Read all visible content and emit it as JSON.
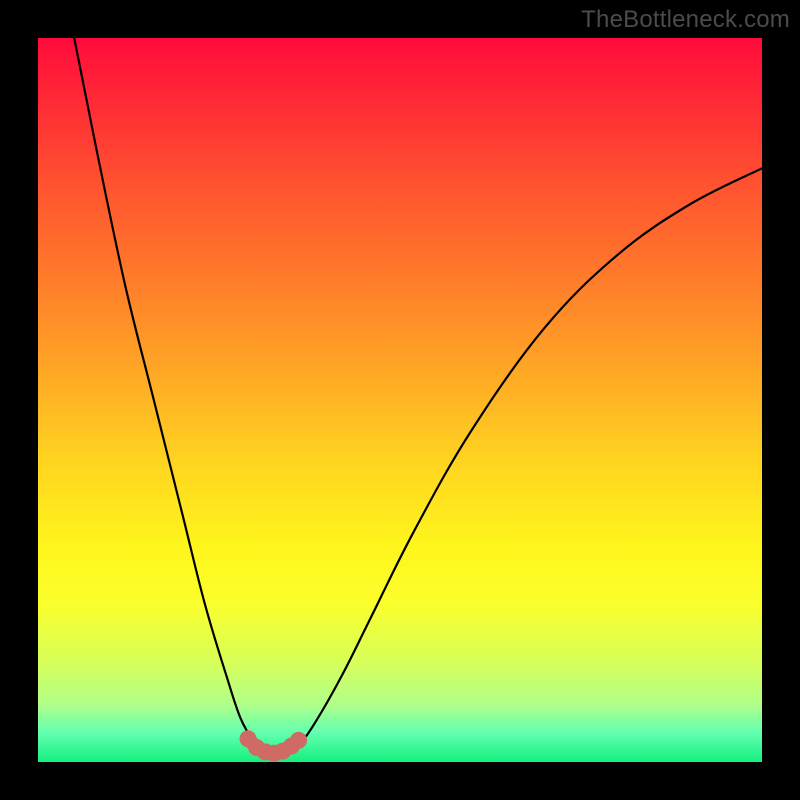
{
  "watermark": "TheBottleneck.com",
  "chart_data": {
    "type": "line",
    "title": "",
    "xlabel": "",
    "ylabel": "",
    "xlim": [
      0,
      100
    ],
    "ylim": [
      0,
      100
    ],
    "grid": false,
    "legend": false,
    "series": [
      {
        "name": "bottleneck-curve",
        "color": "#000000",
        "x": [
          5,
          8,
          12,
          16,
          20,
          23,
          26,
          28,
          30,
          31,
          32.5,
          34,
          36,
          38,
          42,
          46,
          52,
          60,
          70,
          80,
          90,
          100
        ],
        "y": [
          100,
          85,
          66,
          50,
          34,
          22,
          12,
          6,
          2.5,
          1.5,
          1.2,
          1.5,
          2.5,
          5,
          12,
          20,
          32,
          46,
          60,
          70,
          77,
          82
        ]
      }
    ],
    "optimal_region": {
      "name": "optimal-beads",
      "color": "#cf6a65",
      "points": [
        {
          "x": 29.0,
          "y": 3.2
        },
        {
          "x": 30.2,
          "y": 2.0
        },
        {
          "x": 31.4,
          "y": 1.4
        },
        {
          "x": 32.6,
          "y": 1.2
        },
        {
          "x": 33.8,
          "y": 1.5
        },
        {
          "x": 35.0,
          "y": 2.2
        },
        {
          "x": 36.0,
          "y": 3.0
        }
      ]
    },
    "background_gradient": {
      "top": "#ff0b3a",
      "mid": "#ffd220",
      "bottom": "#14f07e"
    }
  }
}
